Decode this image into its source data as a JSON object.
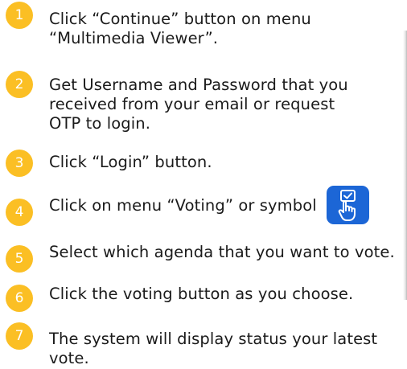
{
  "colors": {
    "badge": "#fbbf24",
    "badge_text": "#ffffff",
    "text": "#1a1a1a",
    "icon_bg": "#1c66d6"
  },
  "steps": [
    {
      "number": "1",
      "text": "Click “Continue” button on menu\n“Multimedia Viewer”."
    },
    {
      "number": "2",
      "text": "Get Username and Password that you\nreceived from your email or request\nOTP to login."
    },
    {
      "number": "3",
      "text": "Click “Login” button."
    },
    {
      "number": "4",
      "text": "Click on menu “Voting” or symbol",
      "icon": "voting-hand-icon"
    },
    {
      "number": "5",
      "text": "Select which agenda that you want to vote."
    },
    {
      "number": "6",
      "text": "Click the voting button as you choose."
    },
    {
      "number": "7",
      "text": "The system will display status your latest\nvote."
    }
  ]
}
